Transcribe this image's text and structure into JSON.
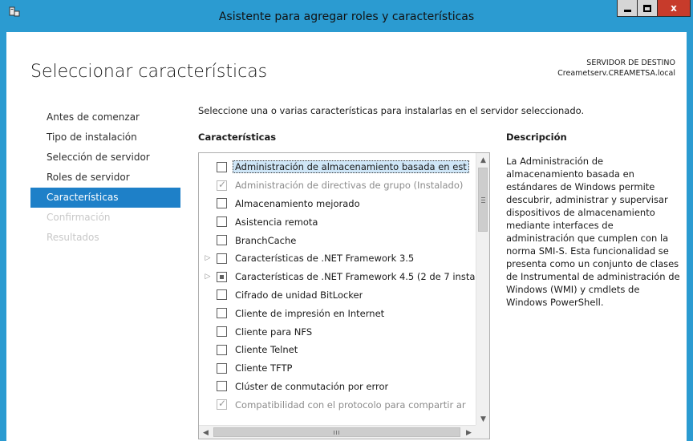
{
  "window": {
    "title": "Asistente para agregar roles y características",
    "min_label": "_",
    "max_label": "□",
    "close_label": "x"
  },
  "page": {
    "title": "Seleccionar características",
    "dest_label": "SERVIDOR DE DESTINO",
    "dest_server": "Creametserv.CREAMETSA.local"
  },
  "nav": [
    {
      "label": "Antes de comenzar",
      "state": "normal"
    },
    {
      "label": "Tipo de instalación",
      "state": "normal"
    },
    {
      "label": "Selección de servidor",
      "state": "normal"
    },
    {
      "label": "Roles de servidor",
      "state": "normal"
    },
    {
      "label": "Características",
      "state": "active"
    },
    {
      "label": "Confirmación",
      "state": "disabled"
    },
    {
      "label": "Resultados",
      "state": "disabled"
    }
  ],
  "main": {
    "intro": "Seleccione una o varias características para instalarlas en el servidor seleccionado.",
    "features_header": "Características",
    "description_header": "Descripción",
    "description": "La Administración de almacenamiento basada en estándares de Windows permite descubrir, administrar y supervisar dispositivos de almacenamiento mediante interfaces de administración que cumplen con la norma SMI-S. Esta funcionalidad se presenta como un conjunto de clases de Instrumental de administración de Windows (WMI) y cmdlets de Windows PowerShell."
  },
  "features": [
    {
      "label": "Administración de almacenamiento basada en est",
      "state": "unchecked",
      "expandable": false,
      "disabled": false,
      "selected": true
    },
    {
      "label": "Administración de directivas de grupo (Instalado)",
      "state": "checked",
      "expandable": false,
      "disabled": true,
      "selected": false
    },
    {
      "label": "Almacenamiento mejorado",
      "state": "unchecked",
      "expandable": false,
      "disabled": false,
      "selected": false
    },
    {
      "label": "Asistencia remota",
      "state": "unchecked",
      "expandable": false,
      "disabled": false,
      "selected": false
    },
    {
      "label": "BranchCache",
      "state": "unchecked",
      "expandable": false,
      "disabled": false,
      "selected": false
    },
    {
      "label": "Características de .NET Framework 3.5",
      "state": "unchecked",
      "expandable": true,
      "disabled": false,
      "selected": false
    },
    {
      "label": "Características de .NET Framework 4.5 (2 de 7 insta",
      "state": "partial",
      "expandable": true,
      "disabled": false,
      "selected": false
    },
    {
      "label": "Cifrado de unidad BitLocker",
      "state": "unchecked",
      "expandable": false,
      "disabled": false,
      "selected": false
    },
    {
      "label": "Cliente de impresión en Internet",
      "state": "unchecked",
      "expandable": false,
      "disabled": false,
      "selected": false
    },
    {
      "label": "Cliente para NFS",
      "state": "unchecked",
      "expandable": false,
      "disabled": false,
      "selected": false
    },
    {
      "label": "Cliente Telnet",
      "state": "unchecked",
      "expandable": false,
      "disabled": false,
      "selected": false
    },
    {
      "label": "Cliente TFTP",
      "state": "unchecked",
      "expandable": false,
      "disabled": false,
      "selected": false
    },
    {
      "label": "Clúster de conmutación por error",
      "state": "unchecked",
      "expandable": false,
      "disabled": false,
      "selected": false
    },
    {
      "label": "Compatibilidad con el protocolo para compartir ar",
      "state": "checked",
      "expandable": false,
      "disabled": true,
      "selected": false
    }
  ]
}
